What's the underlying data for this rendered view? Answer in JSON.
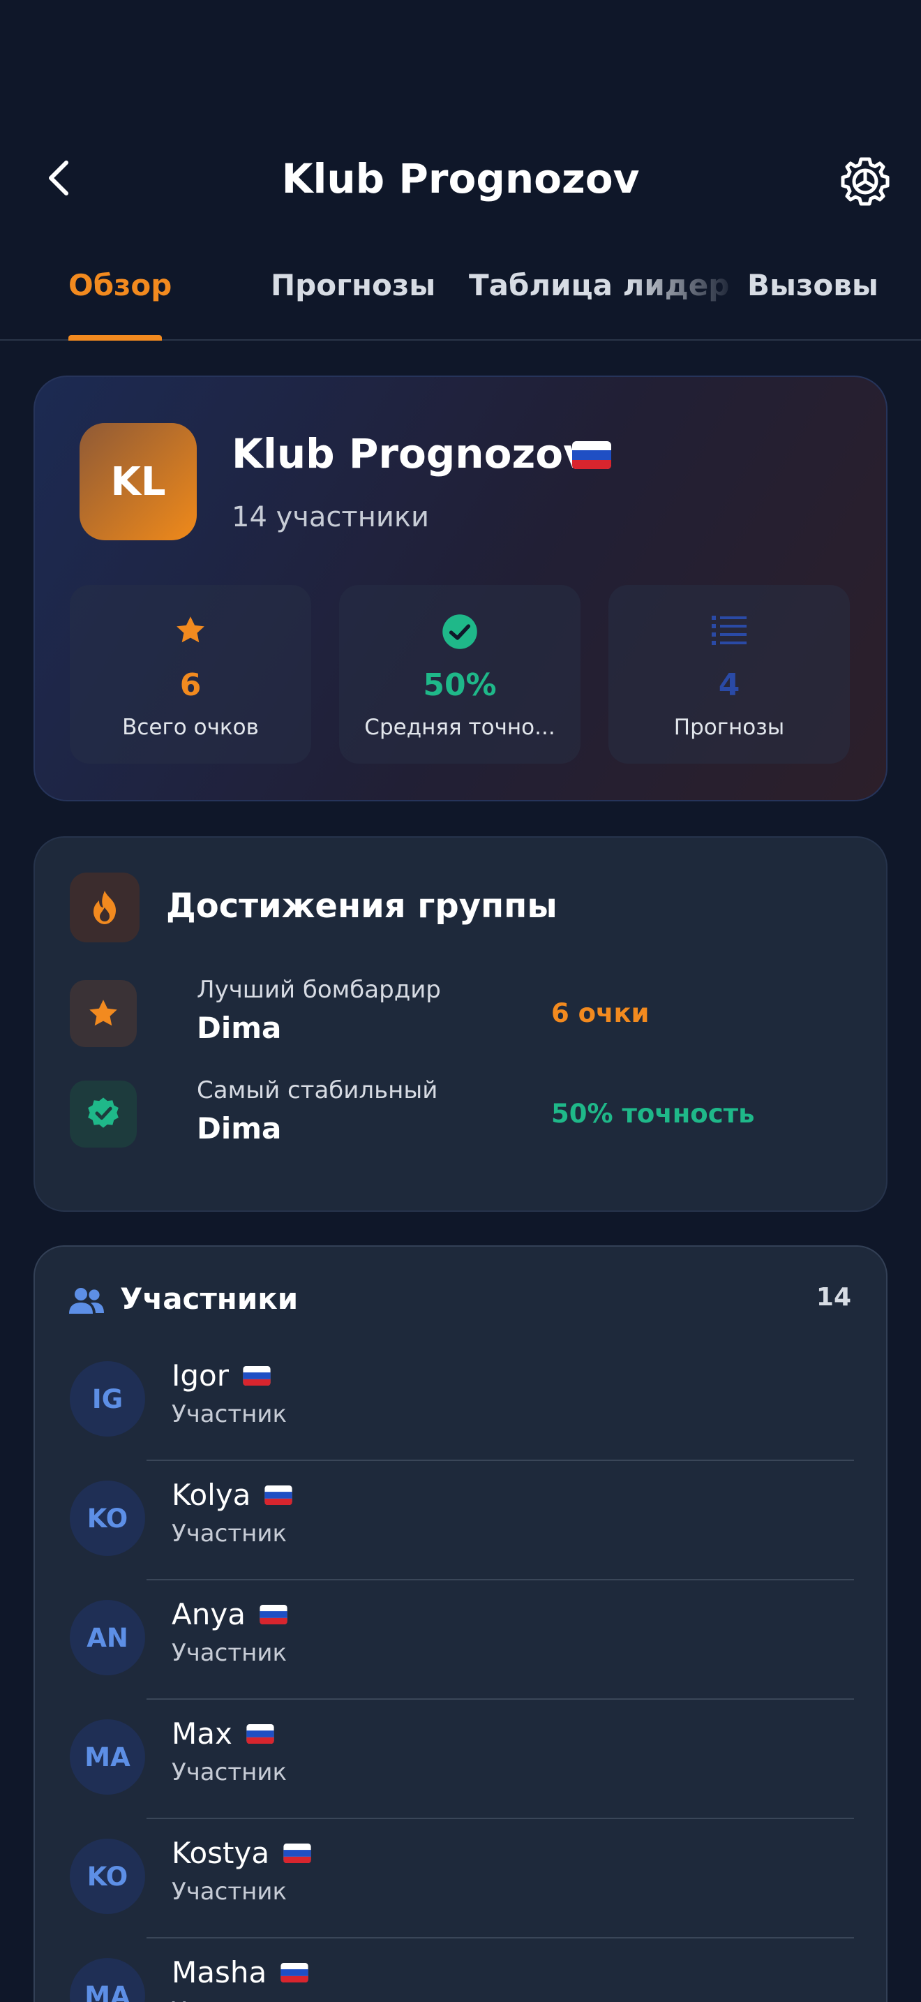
{
  "header": {
    "title": "Klub Prognozov",
    "back_icon": "chevron-left-icon",
    "settings_icon": "gear-icon"
  },
  "tabs": [
    {
      "label": "Обзор",
      "active": true
    },
    {
      "label": "Прогнозы",
      "active": false
    },
    {
      "label": "Таблица лидер",
      "active": false
    },
    {
      "label": "Вызовы",
      "active": false
    }
  ],
  "group": {
    "avatar_initials": "KL",
    "name": "Klub Prognozov",
    "flag": "russia-flag",
    "members_text": "14 участники"
  },
  "stats": [
    {
      "icon": "star-icon",
      "value": "6",
      "label": "Всего очков",
      "color": "#f28a1f"
    },
    {
      "icon": "check-circle-icon",
      "value": "50%",
      "label": "Средняя точно...",
      "color": "#1fb889"
    },
    {
      "icon": "list-icon",
      "value": "4",
      "label": "Прогнозы",
      "color": "#2a4aa6"
    }
  ],
  "achievements": {
    "title": "Достижения группы",
    "icon": "fire-icon",
    "rows": [
      {
        "icon": "star-icon",
        "label": "Лучший бомбардир",
        "name": "Dima",
        "value": "6 очки",
        "color": "#f28a1f"
      },
      {
        "icon": "verified-badge-icon",
        "label": "Самый стабильный",
        "name": "Dima",
        "value": "50% точность",
        "color": "#1fb889"
      }
    ]
  },
  "members": {
    "title": "Участники",
    "icon": "people-icon",
    "count": "14",
    "list": [
      {
        "initials": "IG",
        "name": "Igor",
        "role": "Участник"
      },
      {
        "initials": "KO",
        "name": "Kolya",
        "role": "Участник"
      },
      {
        "initials": "AN",
        "name": "Anya",
        "role": "Участник"
      },
      {
        "initials": "MA",
        "name": "Max",
        "role": "Участник"
      },
      {
        "initials": "KO",
        "name": "Kostya",
        "role": "Участник"
      },
      {
        "initials": "MA",
        "name": "Masha",
        "role": "Участник"
      }
    ]
  },
  "colors": {
    "background": "#0f1729",
    "card": "#1e293b",
    "accent_orange": "#f28a1f",
    "accent_green": "#1fb889",
    "accent_blue": "#2a4aa6"
  }
}
